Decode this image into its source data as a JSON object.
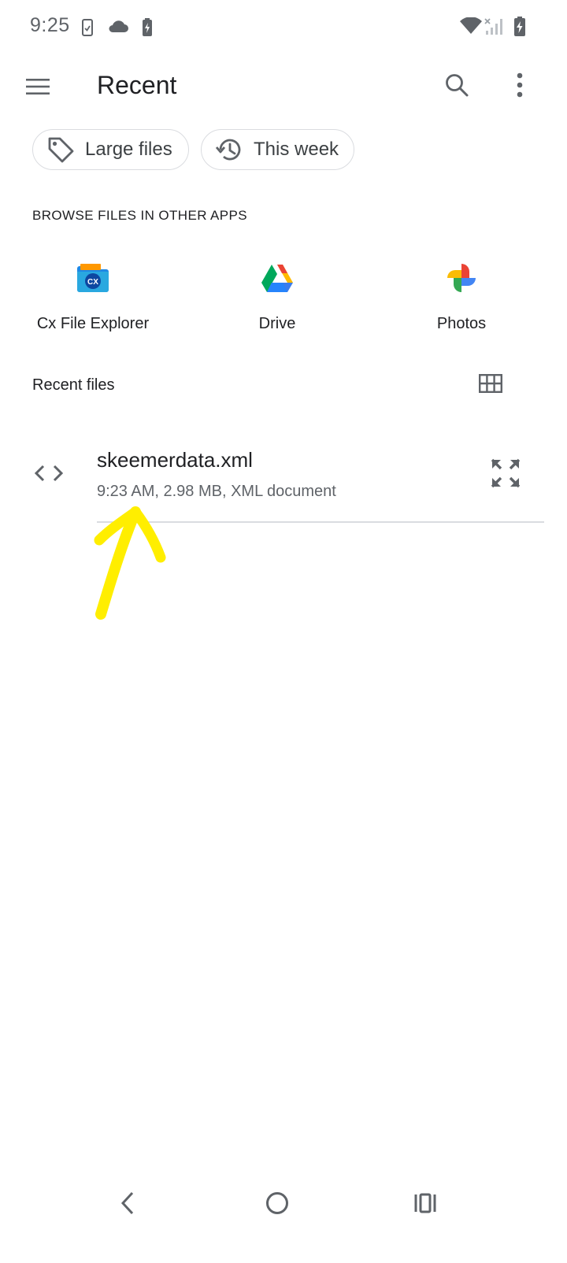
{
  "status_bar": {
    "time": "9:25",
    "icons": [
      "phone-check-icon",
      "cloud-icon",
      "battery-saver-icon",
      "wifi-icon",
      "signal-icon",
      "battery-charging-icon"
    ]
  },
  "app_bar": {
    "title": "Recent",
    "icons": [
      "menu-icon",
      "search-icon",
      "more-vert-icon"
    ]
  },
  "chips": [
    {
      "label": "Large files",
      "icon": "label-tag-icon"
    },
    {
      "label": "This week",
      "icon": "history-icon"
    }
  ],
  "browse": {
    "header": "BROWSE FILES IN OTHER APPS",
    "apps": [
      {
        "label": "Cx File Explorer",
        "icon": "cx-file-explorer-icon"
      },
      {
        "label": "Drive",
        "icon": "google-drive-icon"
      },
      {
        "label": "Photos",
        "icon": "google-photos-icon"
      }
    ]
  },
  "recent": {
    "header": "Recent files",
    "view_toggle_icon": "grid-view-icon",
    "files": [
      {
        "name": "skeemerdata.xml",
        "meta": "9:23 AM, 2.98 MB, XML document",
        "icon": "code-icon",
        "action_icon": "fullscreen-icon"
      }
    ]
  },
  "nav_bar": {
    "icons": [
      "back-icon",
      "home-icon",
      "recents-icon"
    ]
  },
  "colors": {
    "text_primary": "#202124",
    "text_secondary": "#5f6368",
    "divider": "#dadce0",
    "annotation": "#ffee00"
  }
}
